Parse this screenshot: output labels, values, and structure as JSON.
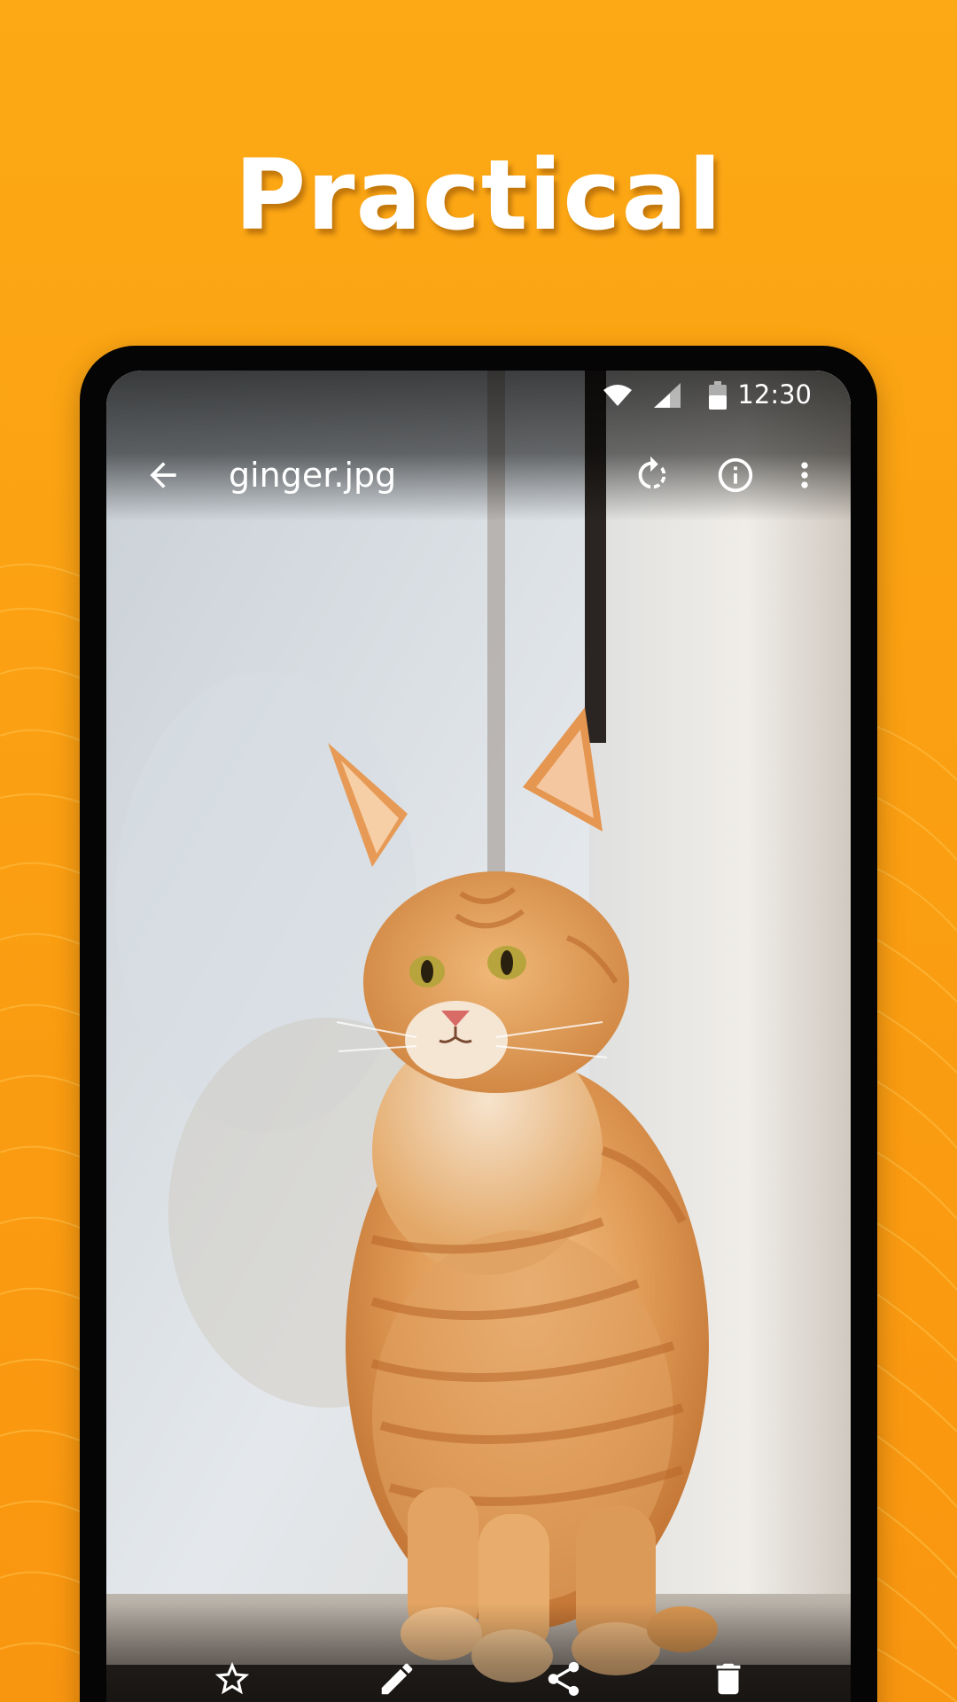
{
  "headline": "Practical",
  "status_bar": {
    "time": "12:30",
    "icons": [
      "wifi-icon",
      "cell-signal-icon",
      "battery-icon"
    ]
  },
  "toolbar": {
    "title": "ginger.jpg",
    "actions": [
      "back-arrow-icon",
      "rotate-icon",
      "info-icon",
      "more-vert-icon"
    ]
  },
  "bottom_actions": [
    "star-outline-icon",
    "pencil-icon",
    "share-icon",
    "trash-icon"
  ],
  "photo": {
    "subject": "orange-tabby-cat",
    "icon": "photo-image"
  },
  "colors": {
    "background": "#fba012",
    "headline": "#ffffff",
    "frame": "#050505",
    "cat_fur": "#d98a3c",
    "window_light": "#e9edf0"
  }
}
